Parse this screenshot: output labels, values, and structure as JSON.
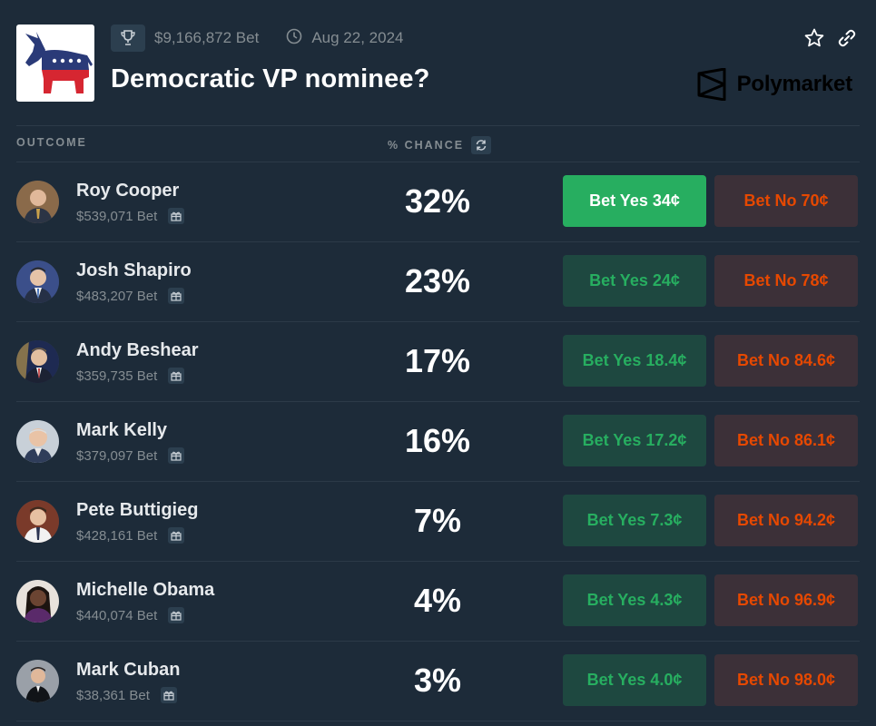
{
  "header": {
    "logo": "democrat-donkey-logo",
    "trophy_icon": "trophy-icon",
    "volume": "$9,166,872 Bet",
    "clock_icon": "clock-icon",
    "date": "Aug 22, 2024",
    "title": "Democratic VP nominee?",
    "brand": "Polymarket"
  },
  "columns": {
    "outcome": "OUTCOME",
    "chance": "% CHANCE"
  },
  "outcomes": [
    {
      "name": "Roy Cooper",
      "bet": "$539,071 Bet",
      "chance": "32%",
      "yes": "Bet Yes 34¢",
      "no": "Bet No 70¢",
      "yes_active": true
    },
    {
      "name": "Josh Shapiro",
      "bet": "$483,207 Bet",
      "chance": "23%",
      "yes": "Bet Yes 24¢",
      "no": "Bet No 78¢"
    },
    {
      "name": "Andy Beshear",
      "bet": "$359,735 Bet",
      "chance": "17%",
      "yes": "Bet Yes 18.4¢",
      "no": "Bet No 84.6¢"
    },
    {
      "name": "Mark Kelly",
      "bet": "$379,097 Bet",
      "chance": "16%",
      "yes": "Bet Yes 17.2¢",
      "no": "Bet No 86.1¢"
    },
    {
      "name": "Pete Buttigieg",
      "bet": "$428,161 Bet",
      "chance": "7%",
      "yes": "Bet Yes 7.3¢",
      "no": "Bet No 94.2¢"
    },
    {
      "name": "Michelle Obama",
      "bet": "$440,074 Bet",
      "chance": "4%",
      "yes": "Bet Yes 4.3¢",
      "no": "Bet No 96.9¢"
    },
    {
      "name": "Mark Cuban",
      "bet": "$38,361 Bet",
      "chance": "3%",
      "yes": "Bet Yes 4.0¢",
      "no": "Bet No 98.0¢"
    }
  ],
  "colors": {
    "background": "#1d2b39",
    "yes": "#27ae60",
    "no": "#e64800"
  }
}
